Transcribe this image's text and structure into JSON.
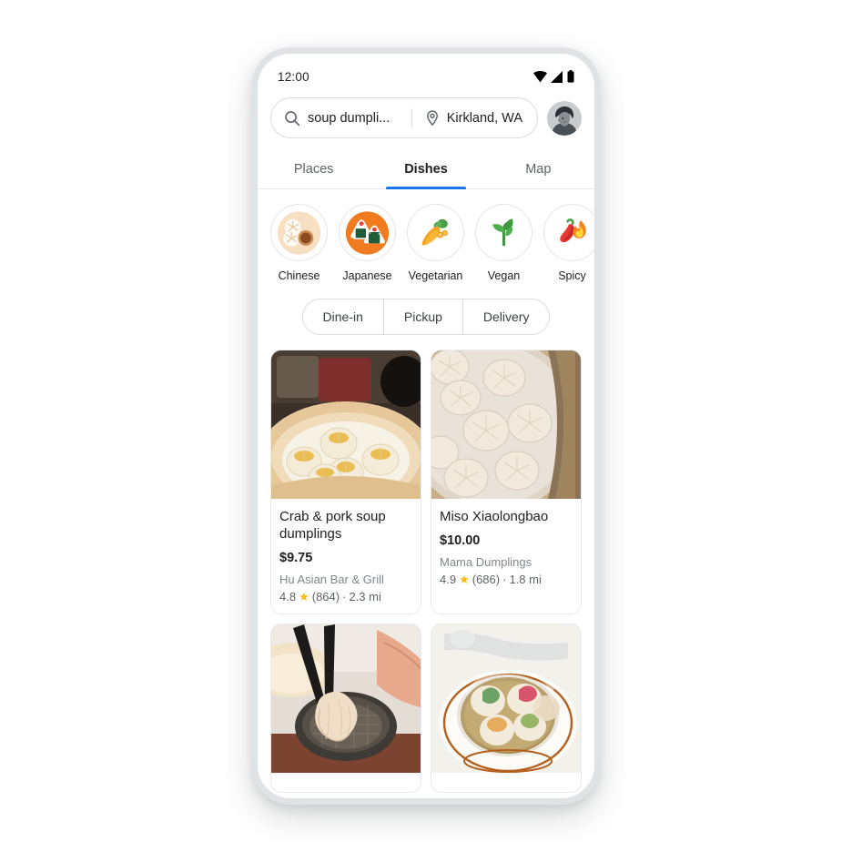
{
  "status_bar": {
    "time": "12:00",
    "icons": [
      "wifi-icon",
      "cellular-signal-icon",
      "battery-icon"
    ]
  },
  "search": {
    "query": "soup dumpli...",
    "location": "Kirkland, WA",
    "search_icon": "search-icon",
    "location_icon": "location-pin-icon",
    "avatar": "user-avatar"
  },
  "tabs": [
    {
      "label": "Places",
      "active": false
    },
    {
      "label": "Dishes",
      "active": true
    },
    {
      "label": "Map",
      "active": false
    }
  ],
  "accent_color": "#1a73e8",
  "star_color": "#fbbc04",
  "categories": [
    {
      "label": "Chinese",
      "icon": "dumpling-icon"
    },
    {
      "label": "Japanese",
      "icon": "onigiri-icon"
    },
    {
      "label": "Vegetarian",
      "icon": "carrot-icon"
    },
    {
      "label": "Vegan",
      "icon": "sprout-icon"
    },
    {
      "label": "Spicy",
      "icon": "chili-flame-icon"
    }
  ],
  "service_filters": [
    "Dine-in",
    "Pickup",
    "Delivery"
  ],
  "dishes": [
    {
      "name": "Crab & pork soup dumplings",
      "price": "$9.75",
      "restaurant": "Hu Asian Bar & Grill",
      "rating": "4.8",
      "reviews": "(864)",
      "distance": "2.3 mi",
      "photo": "soup-dumplings-in-bamboo-steamer"
    },
    {
      "name": "Miso Xiaolongbao",
      "price": "$10.00",
      "restaurant": "Mama Dumplings",
      "rating": "4.9",
      "reviews": "(686)",
      "distance": "1.8 mi",
      "photo": "xiaolongbao-top-down-steamer"
    },
    {
      "name": "",
      "price": "",
      "restaurant": "",
      "rating": "",
      "reviews": "",
      "distance": "",
      "photo": "dumpling-held-with-chopsticks"
    },
    {
      "name": "",
      "price": "",
      "restaurant": "",
      "rating": "",
      "reviews": "",
      "distance": "",
      "photo": "colorful-dumplings-in-broth"
    }
  ],
  "separators": {
    "dot": "·"
  }
}
